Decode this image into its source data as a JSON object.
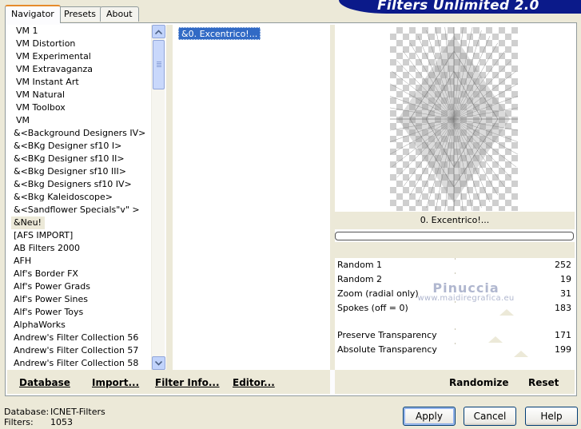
{
  "tabs": [
    "Navigator",
    "Presets",
    "About"
  ],
  "banner_title": "Filters Unlimited 2.0",
  "filters": [
    "VM 1",
    "VM Distortion",
    "VM Experimental",
    "VM Extravaganza",
    "VM Instant Art",
    "VM Natural",
    "VM Toolbox",
    "VM",
    "&<Background Designers IV>",
    "&<BKg Designer sf10 I>",
    "&<BKg Designer sf10 II>",
    "&<Bkg Designer sf10 III>",
    "&<Bkg Designers sf10 IV>",
    "&<Bkg Kaleidoscope>",
    "&<Sandflower Specials\"v\" >",
    "&Neu!",
    "[AFS IMPORT]",
    "AB Filters 2000",
    "AFH",
    "Alf's Border FX",
    "Alf's Power Grads",
    "Alf's Power Sines",
    "Alf's Power Toys",
    "AlphaWorks",
    "Andrew's Filter Collection 56",
    "Andrew's Filter Collection 57",
    "Andrew's Filter Collection 58"
  ],
  "selected_filter": "&Neu!",
  "sub_filter": "&0. Excentrico!...",
  "preview_title": "0. Excentrico!...",
  "params": [
    {
      "label": "Random 1",
      "value": "252"
    },
    {
      "label": "Random 2",
      "value": "19"
    },
    {
      "label": "Zoom (radial only)",
      "value": "31"
    },
    {
      "label": "Spokes (off = 0)",
      "value": "183"
    },
    {
      "label": "Preserve Transparency",
      "value": "171"
    },
    {
      "label": "Absolute  Transparency",
      "value": "199"
    }
  ],
  "watermark": {
    "line1": "Pinuccia",
    "line2": "www.maidiregrafica.eu"
  },
  "bottom_left_buttons": [
    "Database",
    "Import...",
    "Filter Info...",
    "Editor..."
  ],
  "bottom_right_buttons": [
    "Randomize",
    "Reset"
  ],
  "status": {
    "database_label": "Database:",
    "database_value": "ICNET-Filters",
    "filters_label": "Filters:",
    "filters_value": "1053"
  },
  "dialog_buttons": {
    "apply": "Apply",
    "cancel": "Cancel",
    "help": "Help"
  }
}
